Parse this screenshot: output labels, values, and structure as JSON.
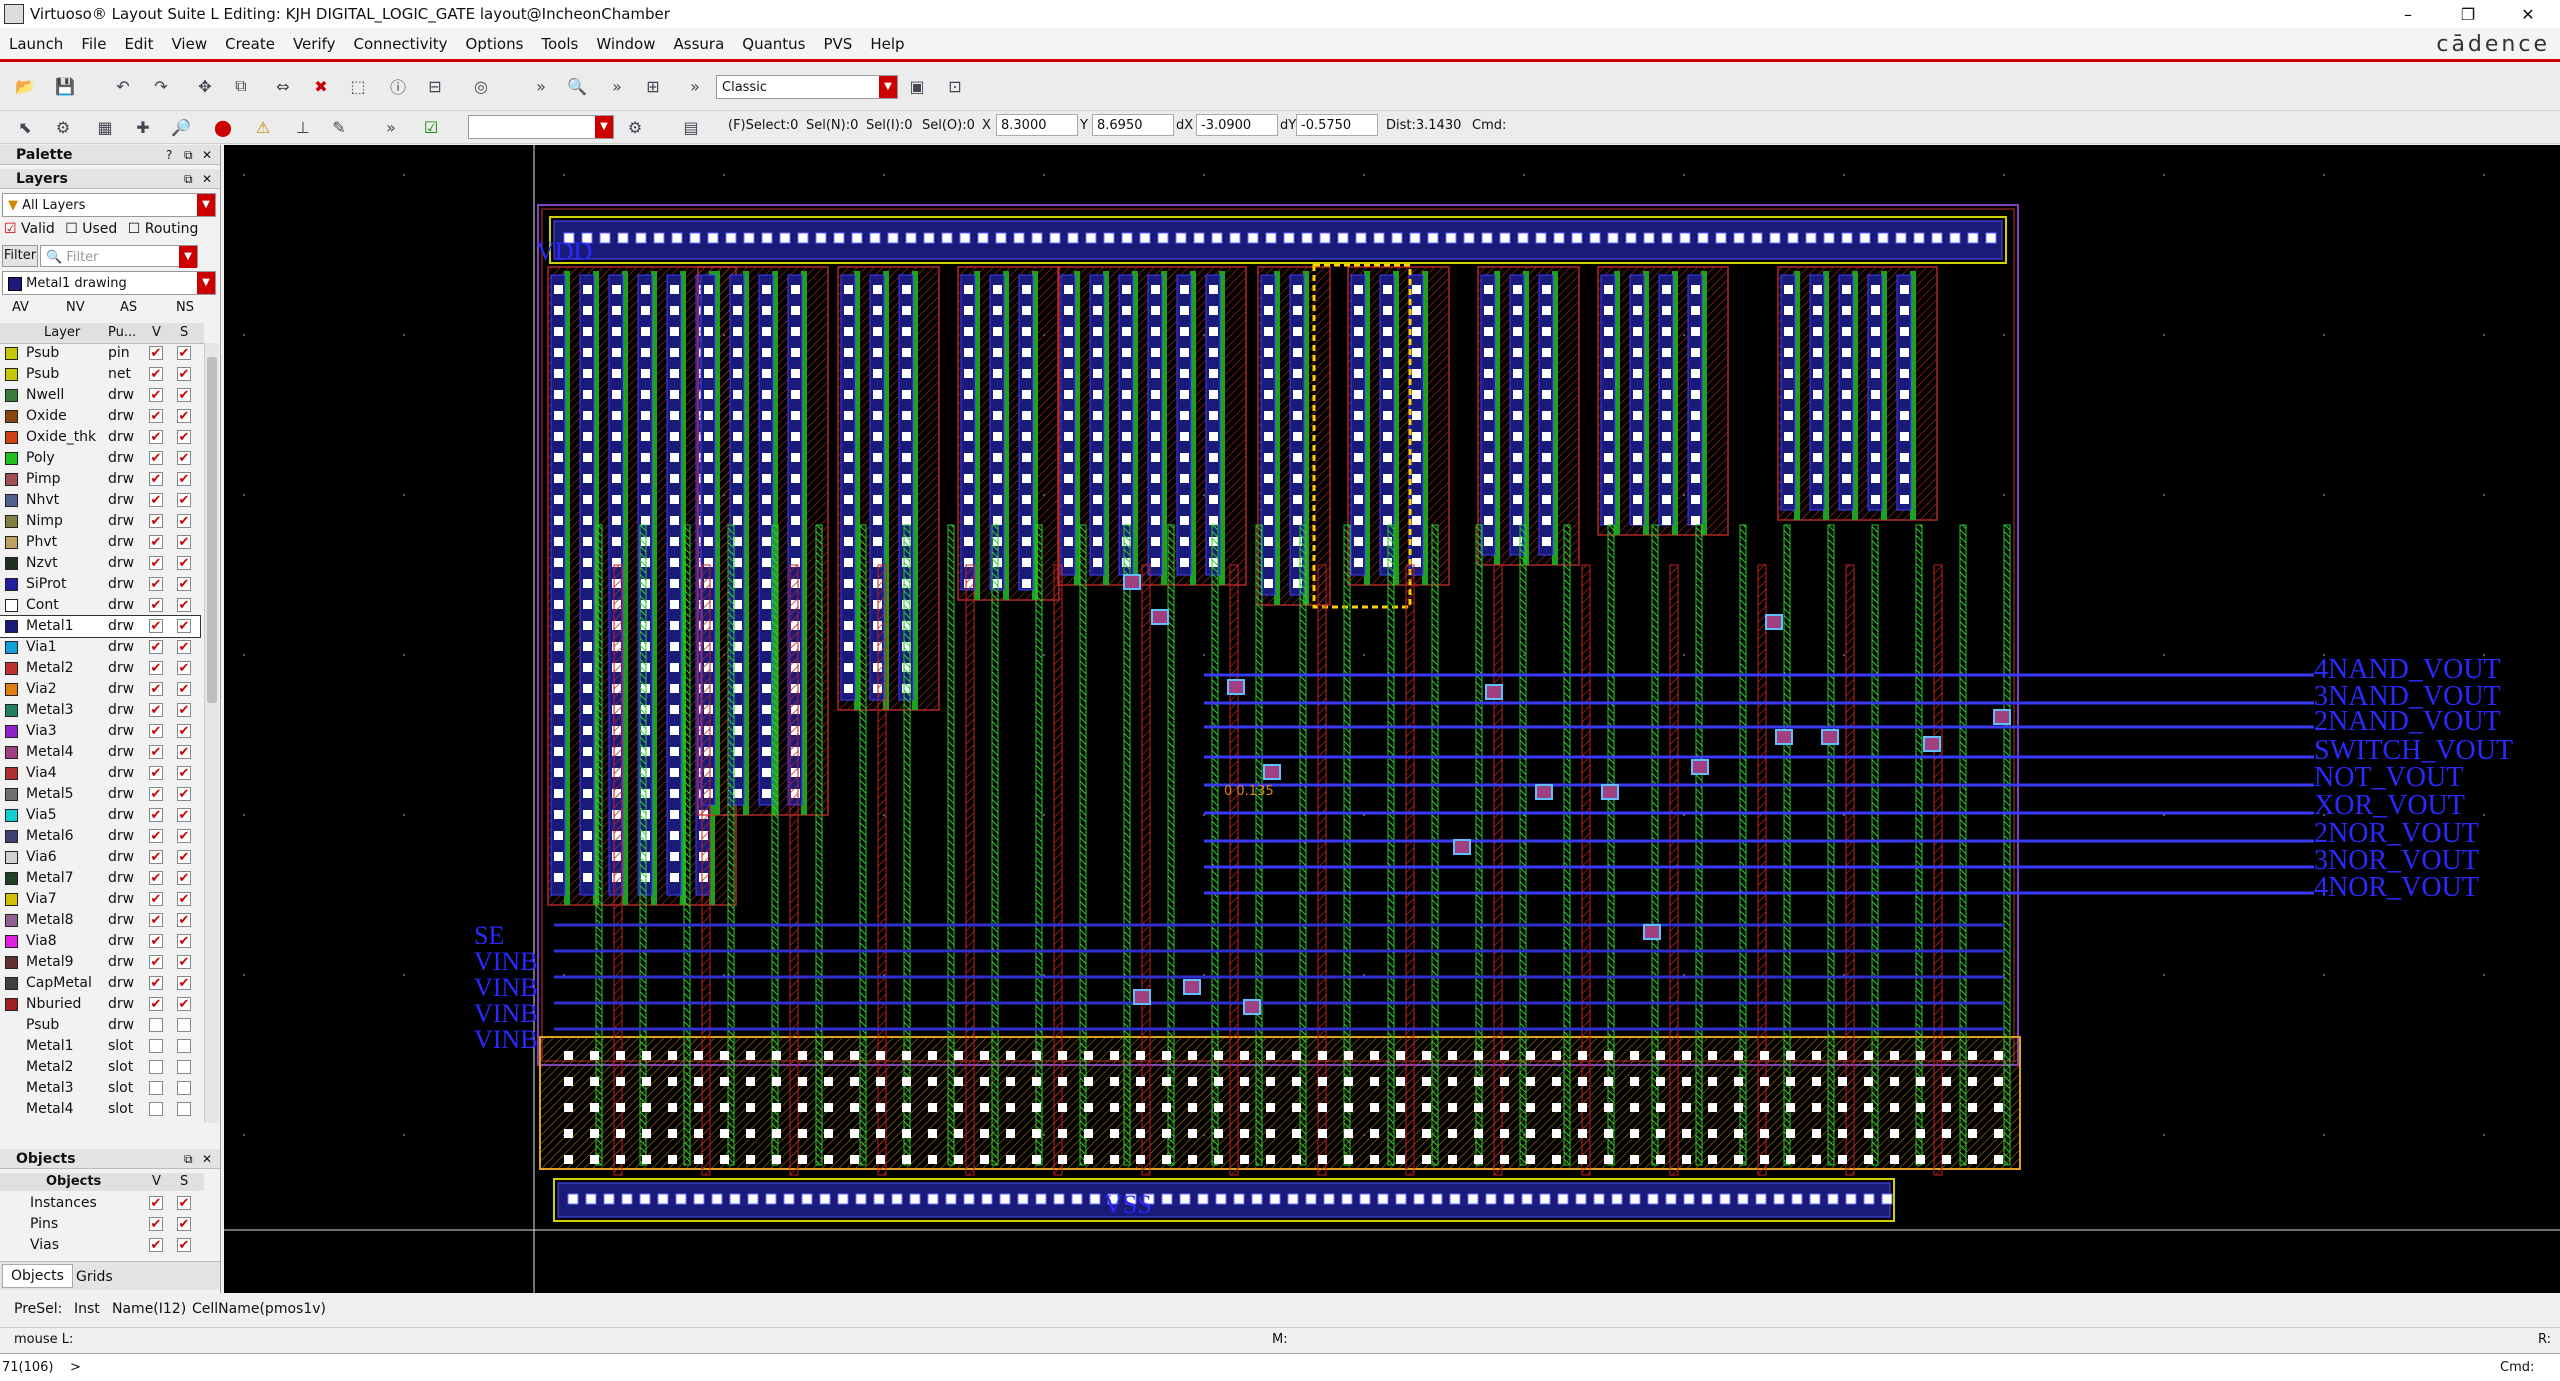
{
  "window": {
    "title": "Virtuoso® Layout Suite L Editing: KJH DIGITAL_LOGIC_GATE layout@IncheonChamber",
    "controls": [
      "–",
      "❐",
      "✕"
    ]
  },
  "menu": {
    "items": [
      "Launch",
      "File",
      "Edit",
      "View",
      "Create",
      "Verify",
      "Connectivity",
      "Options",
      "Tools",
      "Window",
      "Assura",
      "Quantus",
      "PVS",
      "Help"
    ],
    "brand": "cādence"
  },
  "toolbar1": {
    "workspace": "Classic"
  },
  "toolbar2": {
    "status_fields": {
      "fselect": "(F)Select:0",
      "seln": "Sel(N):0",
      "seli": "Sel(I):0",
      "selo": "Sel(O):0"
    },
    "x_label": "X",
    "x_value": "8.3000",
    "y_label": "Y",
    "y_value": "8.6950",
    "dx_label": "dX",
    "dx_value": "-3.0900",
    "dy_label": "dY",
    "dy_value": "-0.5750",
    "dist": "Dist:3.1430",
    "cmd": "Cmd:"
  },
  "palette": {
    "title": "Palette",
    "layers_title": "Layers",
    "filter_select": "All Layers",
    "valid_label": "Valid",
    "used_label": "Used",
    "routing_label": "Routing",
    "filter_button": "Filter",
    "filter_placeholder": "Filter",
    "current_layer": "Metal1 drawing",
    "visibility_buttons": [
      "AV",
      "NV",
      "AS",
      "NS"
    ],
    "columns": [
      "Layer",
      "Pu...",
      "V",
      "S"
    ],
    "layers": [
      {
        "name": "Psub",
        "purpose": "pin",
        "color": "#c8c800",
        "v": true,
        "s": true
      },
      {
        "name": "Psub",
        "purpose": "net",
        "color": "#c8c800",
        "v": true,
        "s": true
      },
      {
        "name": "Nwell",
        "purpose": "drw",
        "color": "#3a7d3a",
        "v": true,
        "s": true
      },
      {
        "name": "Oxide",
        "purpose": "drw",
        "color": "#8b4513",
        "v": true,
        "s": true
      },
      {
        "name": "Oxide_thk",
        "purpose": "drw",
        "color": "#d04010",
        "v": true,
        "s": true
      },
      {
        "name": "Poly",
        "purpose": "drw",
        "color": "#20c020",
        "v": true,
        "s": true
      },
      {
        "name": "Pimp",
        "purpose": "drw",
        "color": "#a05050",
        "v": true,
        "s": true
      },
      {
        "name": "Nhvt",
        "purpose": "drw",
        "color": "#506090",
        "v": true,
        "s": true
      },
      {
        "name": "Nimp",
        "purpose": "drw",
        "color": "#808040",
        "v": true,
        "s": true
      },
      {
        "name": "Phvt",
        "purpose": "drw",
        "color": "#c0a060",
        "v": true,
        "s": true
      },
      {
        "name": "Nzvt",
        "purpose": "drw",
        "color": "#203020",
        "v": true,
        "s": true
      },
      {
        "name": "SiProt",
        "purpose": "drw",
        "color": "#2020a0",
        "v": true,
        "s": true
      },
      {
        "name": "Cont",
        "purpose": "drw",
        "color": "#ffffff",
        "v": true,
        "s": true
      },
      {
        "name": "Metal1",
        "purpose": "drw",
        "color": "#1a1a7a",
        "v": true,
        "s": true
      },
      {
        "name": "Via1",
        "purpose": "drw",
        "color": "#10a0e0",
        "v": true,
        "s": true
      },
      {
        "name": "Metal2",
        "purpose": "drw",
        "color": "#c03030",
        "v": true,
        "s": true
      },
      {
        "name": "Via2",
        "purpose": "drw",
        "color": "#e08010",
        "v": true,
        "s": true
      },
      {
        "name": "Metal3",
        "purpose": "drw",
        "color": "#208060",
        "v": true,
        "s": true
      },
      {
        "name": "Via3",
        "purpose": "drw",
        "color": "#9020d0",
        "v": true,
        "s": true
      },
      {
        "name": "Metal4",
        "purpose": "drw",
        "color": "#a04080",
        "v": true,
        "s": true
      },
      {
        "name": "Via4",
        "purpose": "drw",
        "color": "#b03030",
        "v": true,
        "s": true
      },
      {
        "name": "Metal5",
        "purpose": "drw",
        "color": "#707070",
        "v": true,
        "s": true
      },
      {
        "name": "Via5",
        "purpose": "drw",
        "color": "#10d0d0",
        "v": true,
        "s": true
      },
      {
        "name": "Metal6",
        "purpose": "drw",
        "color": "#404070",
        "v": true,
        "s": true
      },
      {
        "name": "Via6",
        "purpose": "drw",
        "color": "#d0d0d0",
        "v": true,
        "s": true
      },
      {
        "name": "Metal7",
        "purpose": "drw",
        "color": "#204020",
        "v": true,
        "s": true
      },
      {
        "name": "Via7",
        "purpose": "drw",
        "color": "#d0c000",
        "v": true,
        "s": true
      },
      {
        "name": "Metal8",
        "purpose": "drw",
        "color": "#906090",
        "v": true,
        "s": true
      },
      {
        "name": "Via8",
        "purpose": "drw",
        "color": "#e020e0",
        "v": true,
        "s": true
      },
      {
        "name": "Metal9",
        "purpose": "drw",
        "color": "#603030",
        "v": true,
        "s": true
      },
      {
        "name": "CapMetal",
        "purpose": "drw",
        "color": "#404040",
        "v": true,
        "s": true
      },
      {
        "name": "Nburied",
        "purpose": "drw",
        "color": "#a02020",
        "v": true,
        "s": true
      },
      {
        "name": "Psub",
        "purpose": "drw",
        "color": "",
        "v": false,
        "s": false
      },
      {
        "name": "Metal1",
        "purpose": "slot",
        "color": "",
        "v": false,
        "s": false
      },
      {
        "name": "Metal2",
        "purpose": "slot",
        "color": "",
        "v": false,
        "s": false
      },
      {
        "name": "Metal3",
        "purpose": "slot",
        "color": "",
        "v": false,
        "s": false
      },
      {
        "name": "Metal4",
        "purpose": "slot",
        "color": "",
        "v": false,
        "s": false
      }
    ],
    "selected_layer_index": 13,
    "objects_title": "Objects",
    "objects_columns": [
      "Objects",
      "V",
      "S"
    ],
    "objects": [
      "Instances",
      "Pins",
      "Vias"
    ],
    "tabs": [
      "Objects",
      "Grids"
    ]
  },
  "canvas": {
    "net_labels": [
      "4NAND_VOUT",
      "3NAND_VOUT",
      "2NAND_VOUT",
      "SWITCH_VOUT",
      "NOT_VOUT",
      "XOR_VOUT",
      "2NOR_VOUT",
      "3NOR_VOUT",
      "4NOR_VOUT"
    ],
    "left_labels": [
      "SE",
      "VINB",
      "VINB",
      "VINB",
      "VINB"
    ],
    "top_label": "VDD",
    "bottom_label": "VSS",
    "ruler_text": "0  0.135"
  },
  "status": {
    "presel": "PreSel:",
    "inst": "Inst",
    "name": "Name(I12)",
    "cellname": "CellName(pmos1v)",
    "mouse": "mouse L:",
    "m": "M:",
    "r": "R:",
    "counter": "71(106)",
    "prompt": ">",
    "cmd": "Cmd:"
  },
  "colors": {
    "accent_red": "#cc0000",
    "canvas_bg": "#000000",
    "poly": "#20c020",
    "metal1": "#3a3aff",
    "metal2": "#c03030",
    "label_blue": "#2a2aff"
  }
}
